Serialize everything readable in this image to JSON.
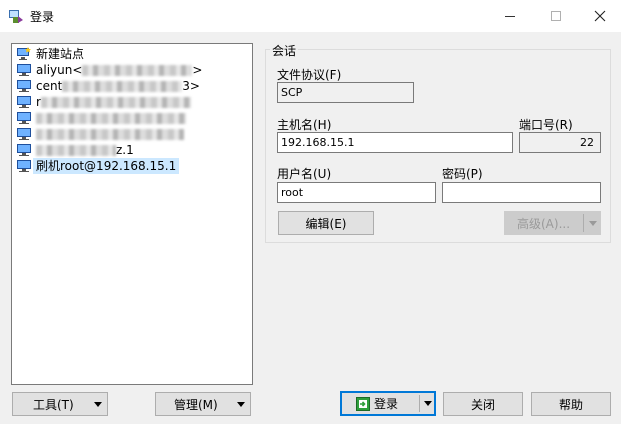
{
  "window": {
    "title": "登录",
    "controls": [
      "minimize",
      "maximize",
      "close"
    ]
  },
  "sites": {
    "items": [
      {
        "label": "新建站点",
        "icon": "new-site-icon",
        "redacted_suffix": false
      },
      {
        "label": "aliyun<",
        "tail": ">",
        "icon": "computer-icon",
        "redacted_suffix": true
      },
      {
        "label": "cent",
        "tail": "3>",
        "icon": "computer-icon",
        "redacted_suffix": true
      },
      {
        "label": "r",
        "tail": "",
        "icon": "computer-icon",
        "redacted_suffix": true
      },
      {
        "label": "",
        "tail": "",
        "icon": "computer-icon",
        "redacted_suffix": true
      },
      {
        "label": "",
        "tail": "",
        "icon": "computer-icon",
        "redacted_suffix": true
      },
      {
        "label": "",
        "tail": "z.1",
        "icon": "computer-icon",
        "redacted_suffix": true
      },
      {
        "label": "刷机root@192.168.15.1",
        "icon": "computer-icon",
        "selected": true,
        "redacted_suffix": false
      }
    ]
  },
  "session": {
    "legend": "会话",
    "protocol_label": "文件协议(F)",
    "protocol_value": "SCP",
    "host_label": "主机名(H)",
    "host_value": "192.168.15.1",
    "port_label": "端口号(R)",
    "port_value": "22",
    "user_label": "用户名(U)",
    "user_value": "root",
    "password_label": "密码(P)",
    "password_value": "",
    "edit_label": "编辑(E)",
    "advanced_label": "高级(A)..."
  },
  "bottom": {
    "tools_label": "工具(T)",
    "manage_label": "管理(M)",
    "login_label": "登录",
    "close_label": "关闭",
    "help_label": "帮助"
  },
  "colors": {
    "accent": "#0078d7",
    "selection": "#cce8ff",
    "login_icon": "#2e9e3a"
  }
}
